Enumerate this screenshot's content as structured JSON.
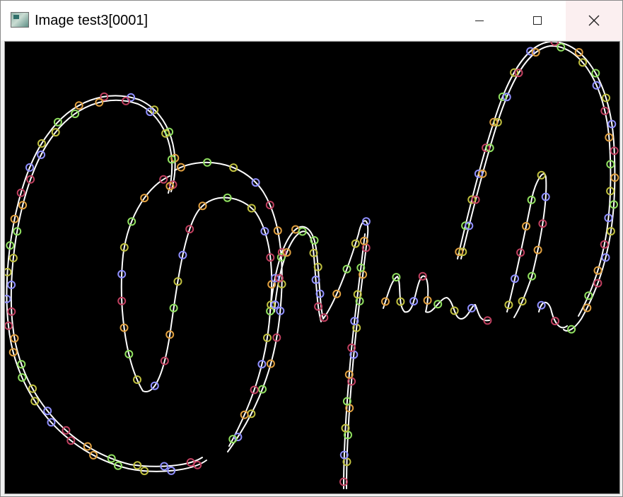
{
  "window": {
    "title": "Image test3[0001]",
    "minimize_icon": "minimize-icon",
    "maximize_icon": "maximize-icon",
    "close_icon": "close-icon"
  },
  "canvas": {
    "background": "#000000",
    "stroke_color": "#ffffff",
    "marker_colors": [
      "#c04060",
      "#40c0a0",
      "#6060e0",
      "#e0a040",
      "#a040e0",
      "#40a0e0",
      "#90e060",
      "#e04080",
      "#80c0c0",
      "#c0c040",
      "#e060e0",
      "#60e0e0",
      "#9090ff",
      "#ff9090",
      "#b0b0b0"
    ]
  }
}
